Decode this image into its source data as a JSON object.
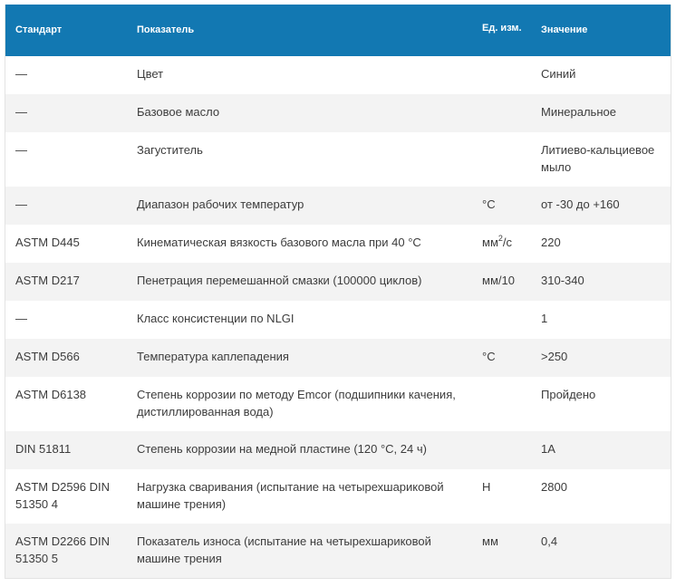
{
  "table": {
    "headers": {
      "standard": "Стандарт",
      "indicator": "Показатель",
      "unit": "Ед. изм.",
      "value": "Значение"
    },
    "rows": [
      {
        "standard": "—",
        "indicator": "Цвет",
        "unit": "",
        "unit_sup": "",
        "value": "Синий"
      },
      {
        "standard": "—",
        "indicator": "Базовое масло",
        "unit": "",
        "unit_sup": "",
        "value": "Минеральное"
      },
      {
        "standard": "—",
        "indicator": "Загуститель",
        "unit": "",
        "unit_sup": "",
        "value": "Литиево-кальциевое мыло"
      },
      {
        "standard": "—",
        "indicator": "Диапазон рабочих температур",
        "unit": "°C",
        "unit_sup": "",
        "value": "от -30 до +160"
      },
      {
        "standard": "ASTM D445",
        "indicator": "Кинематическая вязкость базового масла при 40 °C",
        "unit": "мм",
        "unit_sup": "2",
        "unit_tail": "/с",
        "value": "220"
      },
      {
        "standard": "ASTM D217",
        "indicator": "Пенетрация перемешанной смазки (100000 циклов)",
        "unit": "мм/10",
        "unit_sup": "",
        "value": "310-340"
      },
      {
        "standard": "—",
        "indicator": "Класс консистенции по NLGI",
        "unit": "",
        "unit_sup": "",
        "value": "1"
      },
      {
        "standard": "ASTM D566",
        "indicator": "Температура каплепадения",
        "unit": "°C",
        "unit_sup": "",
        "value": ">250"
      },
      {
        "standard": "ASTM D6138",
        "indicator": "Степень коррозии по методу Emcor (подшипники качения, дистиллированная вода)",
        "unit": "",
        "unit_sup": "",
        "value": "Пройдено"
      },
      {
        "standard": "DIN 51811",
        "indicator": "Степень коррозии на медной пластине (120 °C, 24 ч)",
        "unit": "",
        "unit_sup": "",
        "value": "1A"
      },
      {
        "standard": "ASTM D2596 DIN 51350 4",
        "indicator": "Нагрузка сваривания (испытание на четырехшариковой машине трения)",
        "unit": "Н",
        "unit_sup": "",
        "value": "2800"
      },
      {
        "standard": "ASTM D2266 DIN 51350 5",
        "indicator": "Показатель износа (испытание на четырехшариковой машине трения",
        "unit": "мм",
        "unit_sup": "",
        "value": "0,4"
      }
    ]
  }
}
